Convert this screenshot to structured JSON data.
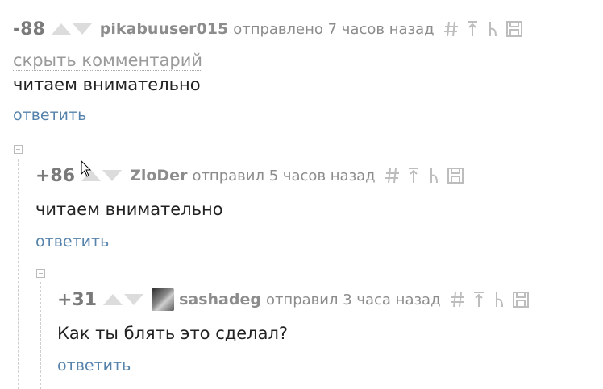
{
  "comments": [
    {
      "rating": "-88",
      "author": "pikabuuser015",
      "meta": "отправлено 7 часов назад",
      "hide_label": "скрыть комментарий",
      "text": "читаем внимательно",
      "reply": "ответить"
    },
    {
      "rating": "+86",
      "author": "ZloDer",
      "meta": "отправил 5 часов назад",
      "text": "читаем внимательно",
      "reply": "ответить"
    },
    {
      "rating": "+31",
      "author": "sashadeg",
      "meta": "отправил 3 часа назад",
      "text": "Как ты блять это сделал?",
      "reply": "ответить"
    }
  ],
  "icons": [
    "hash-icon",
    "arrow-up-to-parent-icon",
    "branch-icon",
    "save-icon",
    "avatar",
    "collapse-icon"
  ],
  "colors": {
    "reply_link": "#5683ac",
    "meta_gray": "#8c8c8c",
    "vote_arrow": "#dcdcdc"
  }
}
